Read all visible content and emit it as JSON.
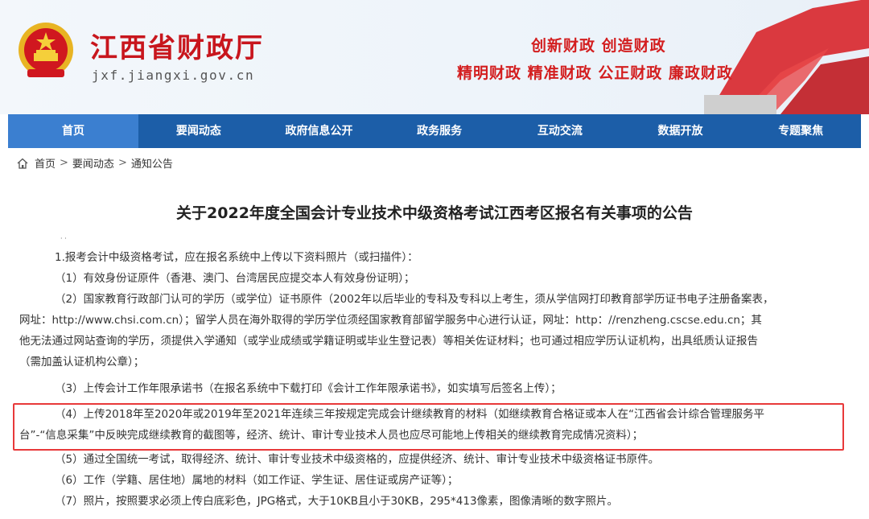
{
  "header": {
    "site_title": "江西省财政厅",
    "site_domain": "jxf.jiangxi.gov.cn",
    "slogan_line1": "创新财政  创造财政",
    "slogan_line2": "精明财政  精准财政  公正财政  廉政财政",
    "colors": {
      "brand_red": "#c8161d",
      "nav_blue": "#1c5ea8",
      "nav_active": "#3b7fd0",
      "highlight_border": "#e8393a"
    }
  },
  "nav": {
    "items": [
      "首页",
      "要闻动态",
      "政府信息公开",
      "政务服务",
      "互动交流",
      "数据开放",
      "专题聚焦"
    ],
    "active": "首页"
  },
  "breadcrumb": {
    "icon": "home-icon",
    "items": [
      "首页",
      "要闻动态",
      "通知公告"
    ],
    "separator": ">"
  },
  "article": {
    "title": "关于2022年度全国会计专业技术中级资格考试江西考区报名有关事项的公告",
    "dots": "· ·",
    "lines": [
      "1.报考会计中级资格考试，应在报名系统中上传以下资料照片（或扫描件）：",
      "（1）有效身份证原件（香港、澳门、台湾居民应提交本人有效身份证明）；",
      "（2）国家教育行政部门认可的学历（或学位）证书原件（2002年以后毕业的专科及专科以上考生，须从学信网打印教育部学历证书电子注册备案表，",
      "网址：http://www.chsi.com.cn）；留学人员在海外取得的学历学位须经国家教育部留学服务中心进行认证，网址：http：//renzheng.cscse.edu.cn；其",
      "他无法通过网站查询的学历，须提供入学通知（或学业成绩或学籍证明或毕业生登记表）等相关佐证材料；也可通过相应学历认证机构，出具纸质认证报告",
      "（需加盖认证机构公章）；",
      "（3）上传会计工作年限承诺书（在报名系统中下载打印《会计工作年限承诺书》，如实填写后签名上传）；",
      "（4）上传2018年至2020年或2019年至2021年连续三年按规定完成会计继续教育的材料（如继续教育合格证或本人在“江西省会计综合管理服务平",
      "台”-“信息采集”中反映完成继续教育的截图等，经济、统计、审计专业技术人员也应尽可能地上传相关的继续教育完成情况资料）；",
      "（5）通过全国统一考试，取得经济、统计、审计专业技术中级资格的，应提供经济、统计、审计专业技术中级资格证书原件。",
      "（6）工作（学籍、居住地）属地的材料（如工作证、学生证、居住证或房产证等）；",
      "（7）照片，按照要求必须上传白底彩色，JPG格式，大于10KB且小于30KB，295*413像素，图像清晰的数字照片。"
    ]
  }
}
